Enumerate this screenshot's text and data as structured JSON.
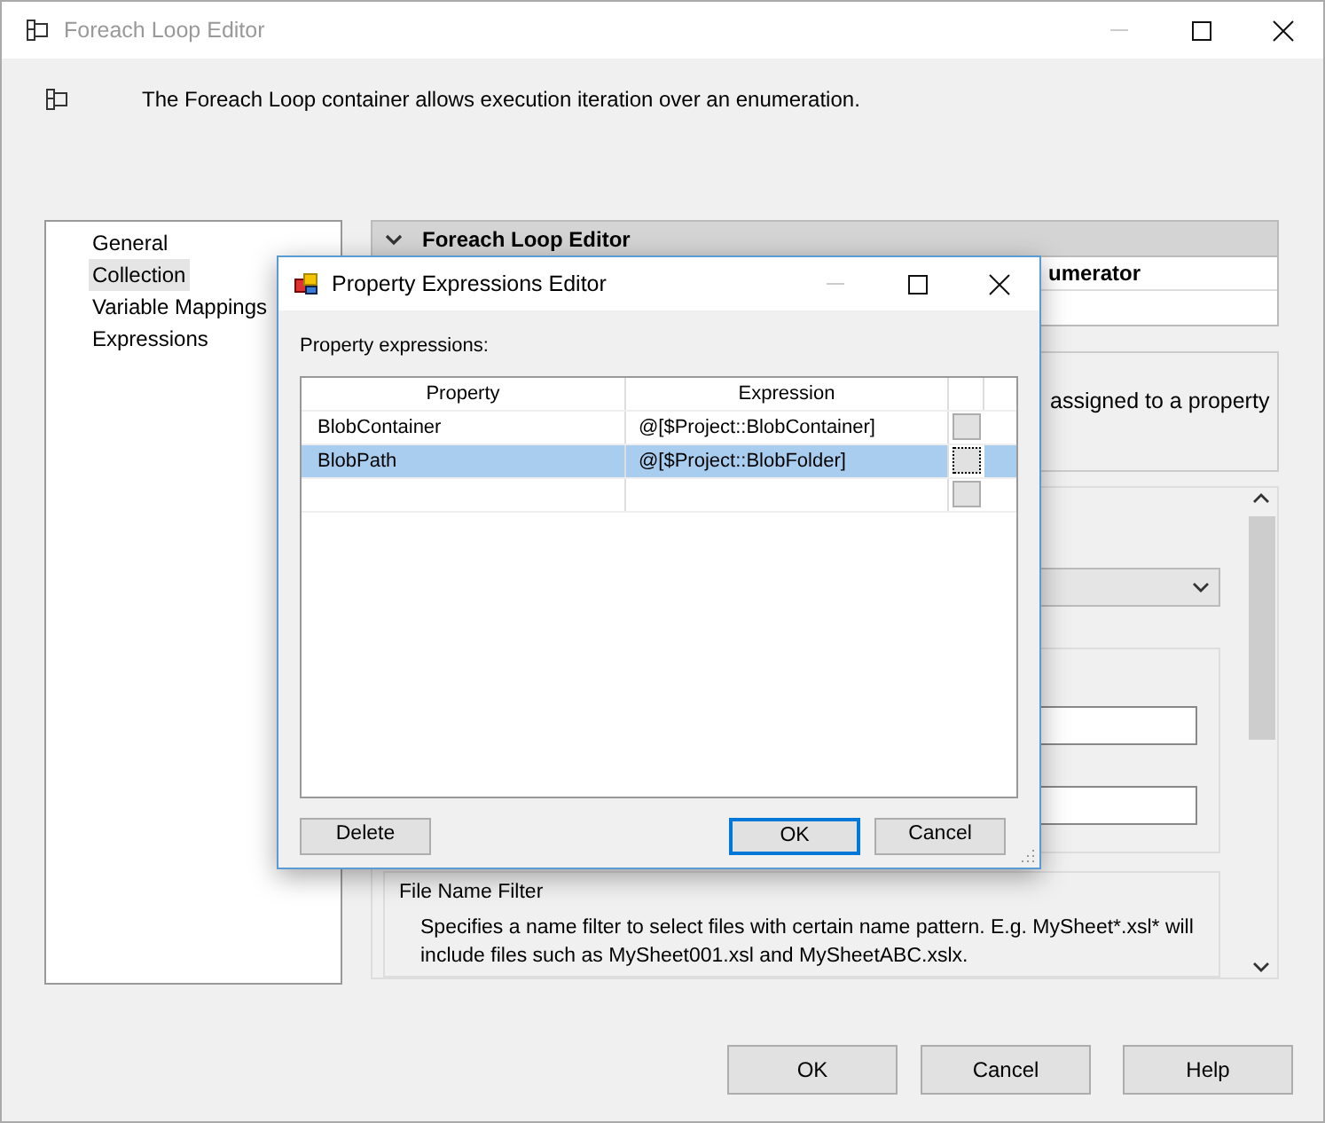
{
  "window": {
    "title": "Foreach Loop Editor"
  },
  "description": "The Foreach Loop container allows execution iteration over an enumeration.",
  "nav": [
    {
      "label": "General",
      "selected": false
    },
    {
      "label": "Collection",
      "selected": true
    },
    {
      "label": "Variable Mappings",
      "selected": false
    },
    {
      "label": "Expressions",
      "selected": false
    }
  ],
  "editor": {
    "header": "Foreach Loop Editor",
    "expanded": true,
    "enumerator_label": "umerator",
    "help_text": "assigned to a property",
    "file_name_filter": {
      "title": "File Name Filter",
      "description": "Specifies a name filter to select files with certain name pattern. E.g. MySheet*.xsl* will include files such as MySheet001.xsl and MySheetABC.xslx."
    }
  },
  "buttons": [
    {
      "label": "OK"
    },
    {
      "label": "Cancel"
    },
    {
      "label": "Help"
    }
  ],
  "dialog": {
    "title": "Property Expressions Editor",
    "label": "Property expressions:",
    "columns": [
      "Property",
      "Expression"
    ],
    "rows": [
      {
        "property": "BlobContainer",
        "expression": "@[$Project::BlobContainer]",
        "selected": false
      },
      {
        "property": "BlobPath",
        "expression": "@[$Project::BlobFolder]",
        "selected": true
      }
    ],
    "buttons": [
      {
        "label": "Delete",
        "default": false
      },
      {
        "label": "OK",
        "default": true
      },
      {
        "label": "Cancel",
        "default": false
      }
    ]
  }
}
